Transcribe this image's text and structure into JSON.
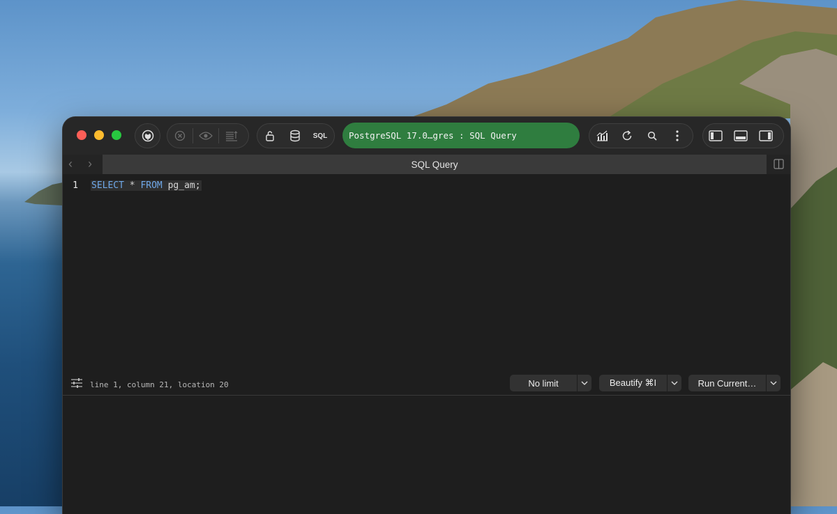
{
  "titlebar": {
    "connection_label": "PostgreSQL 17.0…gres : SQL Query",
    "sql_button_label": "SQL",
    "icons": [
      "plug-icon",
      "stop-icon",
      "eye-icon",
      "list-icon",
      "lock-icon",
      "database-icon",
      "chart-icon",
      "refresh-icon",
      "search-icon",
      "more-icon",
      "left-panel-icon",
      "bottom-panel-icon",
      "right-panel-icon"
    ]
  },
  "tabbar": {
    "tab_label": "SQL Query"
  },
  "editor": {
    "line_number": "1",
    "code": {
      "kw1": "SELECT",
      "star": "*",
      "kw2": "FROM",
      "table": "pg_am;"
    }
  },
  "status": {
    "cursor_info": "line 1, column 21, location 20"
  },
  "buttons": {
    "limit": "No limit",
    "beautify": "Beautify ⌘I",
    "run": "Run Current…"
  },
  "colors": {
    "connection_pill": "#2f7d3f",
    "keyword": "#6fa8e8",
    "window_bg": "#1e1e1e"
  }
}
